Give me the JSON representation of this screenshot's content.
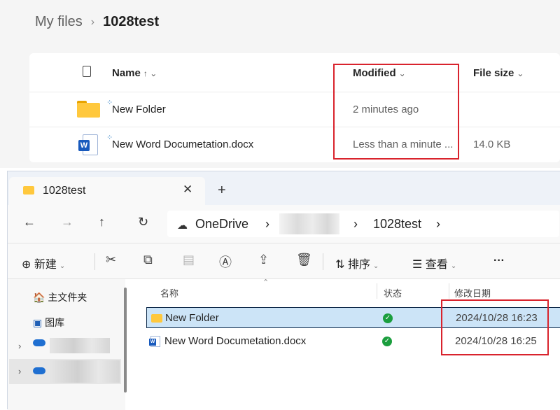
{
  "web": {
    "breadcrumb_root": "My files",
    "breadcrumb_sep": "›",
    "breadcrumb_current": "1028test",
    "headers": {
      "name": "Name",
      "name_sort": "↑ ⌄",
      "modified": "Modified",
      "modified_arrow": "⌄",
      "size": "File size",
      "size_arrow": "⌄"
    },
    "rows": [
      {
        "name": "New Folder",
        "modified": "2 minutes ago",
        "size": "",
        "icon": "folder-icon"
      },
      {
        "name": "New Word Documetation.docx",
        "modified": "Less than a minute ...",
        "size": "14.0 KB",
        "icon": "word-doc-icon"
      }
    ]
  },
  "explorer": {
    "tab_title": "1028test",
    "tab_close": "✕",
    "new_tab": "+",
    "nav": {
      "back": "←",
      "forward": "→",
      "up": "↑",
      "refresh": "↻"
    },
    "address": {
      "cloud": "☁",
      "root": "OneDrive",
      "sep1": "›",
      "sep2": "›",
      "folder": "1028test",
      "sep3": "›"
    },
    "toolbar": {
      "new_icon": "⊕",
      "new": "新建",
      "sort_icon": "⇅",
      "sort": "排序",
      "view_icon": "☰",
      "view": "查看",
      "more": "···",
      "dropdown": "⌄"
    },
    "sidebar": {
      "home": "主文件夹",
      "gallery": "图库",
      "chev": "›"
    },
    "columns": {
      "name": "名称",
      "status": "状态",
      "date": "修改日期"
    },
    "files": [
      {
        "name": "New Folder",
        "date": "2024/10/28 16:23",
        "status": "synced"
      },
      {
        "name": "New Word Documetation.docx",
        "date": "2024/10/28 16:25",
        "status": "synced"
      }
    ],
    "status_glyph": "✓"
  },
  "colors": {
    "highlight": "#d9232d",
    "selection": "#cce4f7",
    "accent": "#0f6cbd",
    "folder": "#ffc83d",
    "synced": "#1b9e3e"
  }
}
